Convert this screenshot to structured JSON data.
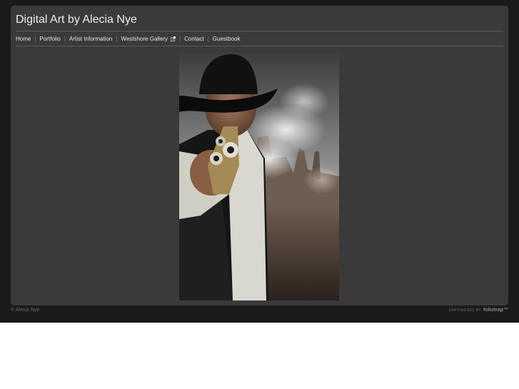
{
  "site": {
    "title": "Digital Art by Alecia Nye"
  },
  "nav": {
    "items": [
      {
        "label": "Home",
        "external": false
      },
      {
        "label": "Portfolio",
        "external": false
      },
      {
        "label": "Artist Information",
        "external": false
      },
      {
        "label": "Westshore Gallery",
        "external": true
      },
      {
        "label": "Contact",
        "external": false
      },
      {
        "label": "Guestbook",
        "external": false
      }
    ],
    "separator": "|"
  },
  "artwork": {
    "description_icon": "cowboy-photo"
  },
  "footer": {
    "copyright": "© Alecia Nye",
    "powered_prefix": "EMPOWERED BY",
    "powered_brand": "foliotrap™"
  },
  "colors": {
    "page_background": "#1a1a1a",
    "panel_background": "#3a3a3a",
    "text": "#eeeeee",
    "divider": "#5c5c5c"
  }
}
